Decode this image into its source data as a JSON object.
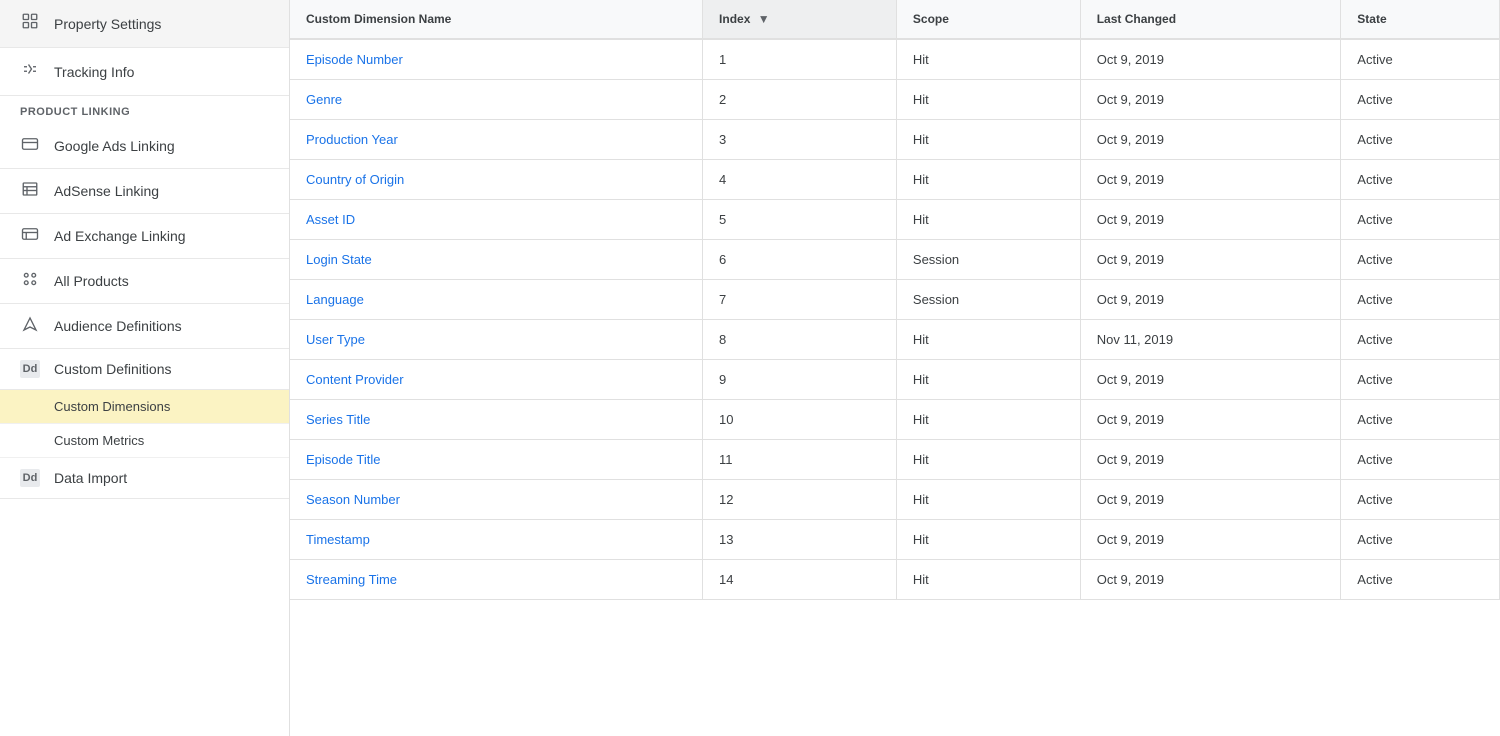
{
  "sidebar": {
    "items": [
      {
        "id": "property-settings",
        "label": "Property Settings",
        "icon": "property",
        "type": "main"
      },
      {
        "id": "tracking-info",
        "label": "Tracking Info",
        "icon": "tracking",
        "type": "main"
      }
    ],
    "section_product_linking": "PRODUCT LINKING",
    "product_linking_items": [
      {
        "id": "google-ads-linking",
        "label": "Google Ads Linking",
        "icon": "google-ads"
      },
      {
        "id": "adsense-linking",
        "label": "AdSense Linking",
        "icon": "adsense"
      },
      {
        "id": "ad-exchange-linking",
        "label": "Ad Exchange Linking",
        "icon": "ad-exchange"
      },
      {
        "id": "all-products",
        "label": "All Products",
        "icon": "all-products"
      }
    ],
    "audience_definitions": {
      "id": "audience-definitions",
      "label": "Audience Definitions",
      "icon": "audience"
    },
    "custom_definitions": {
      "id": "custom-definitions",
      "label": "Custom Definitions",
      "icon": "dd",
      "badge": "Dd"
    },
    "sub_items": [
      {
        "id": "custom-dimensions",
        "label": "Custom Dimensions",
        "active": true
      },
      {
        "id": "custom-metrics",
        "label": "Custom Metrics",
        "active": false
      }
    ],
    "data_import": {
      "id": "data-import",
      "label": "Data Import",
      "icon": "dd",
      "badge": "Dd"
    }
  },
  "table": {
    "columns": [
      {
        "id": "name",
        "label": "Custom Dimension Name",
        "sortable": false
      },
      {
        "id": "index",
        "label": "Index",
        "sortable": true,
        "sort_direction": "desc"
      },
      {
        "id": "scope",
        "label": "Scope",
        "sortable": false
      },
      {
        "id": "last_changed",
        "label": "Last Changed",
        "sortable": false
      },
      {
        "id": "state",
        "label": "State",
        "sortable": false
      }
    ],
    "rows": [
      {
        "name": "Episode Number",
        "index": "1",
        "scope": "Hit",
        "last_changed": "Oct 9, 2019",
        "state": "Active"
      },
      {
        "name": "Genre",
        "index": "2",
        "scope": "Hit",
        "last_changed": "Oct 9, 2019",
        "state": "Active"
      },
      {
        "name": "Production Year",
        "index": "3",
        "scope": "Hit",
        "last_changed": "Oct 9, 2019",
        "state": "Active"
      },
      {
        "name": "Country of Origin",
        "index": "4",
        "scope": "Hit",
        "last_changed": "Oct 9, 2019",
        "state": "Active"
      },
      {
        "name": "Asset ID",
        "index": "5",
        "scope": "Hit",
        "last_changed": "Oct 9, 2019",
        "state": "Active"
      },
      {
        "name": "Login State",
        "index": "6",
        "scope": "Session",
        "last_changed": "Oct 9, 2019",
        "state": "Active"
      },
      {
        "name": "Language",
        "index": "7",
        "scope": "Session",
        "last_changed": "Oct 9, 2019",
        "state": "Active"
      },
      {
        "name": "User Type",
        "index": "8",
        "scope": "Hit",
        "last_changed": "Nov 11, 2019",
        "state": "Active"
      },
      {
        "name": "Content Provider",
        "index": "9",
        "scope": "Hit",
        "last_changed": "Oct 9, 2019",
        "state": "Active"
      },
      {
        "name": "Series Title",
        "index": "10",
        "scope": "Hit",
        "last_changed": "Oct 9, 2019",
        "state": "Active"
      },
      {
        "name": "Episode Title",
        "index": "11",
        "scope": "Hit",
        "last_changed": "Oct 9, 2019",
        "state": "Active"
      },
      {
        "name": "Season Number",
        "index": "12",
        "scope": "Hit",
        "last_changed": "Oct 9, 2019",
        "state": "Active"
      },
      {
        "name": "Timestamp",
        "index": "13",
        "scope": "Hit",
        "last_changed": "Oct 9, 2019",
        "state": "Active"
      },
      {
        "name": "Streaming Time",
        "index": "14",
        "scope": "Hit",
        "last_changed": "Oct 9, 2019",
        "state": "Active"
      }
    ]
  }
}
